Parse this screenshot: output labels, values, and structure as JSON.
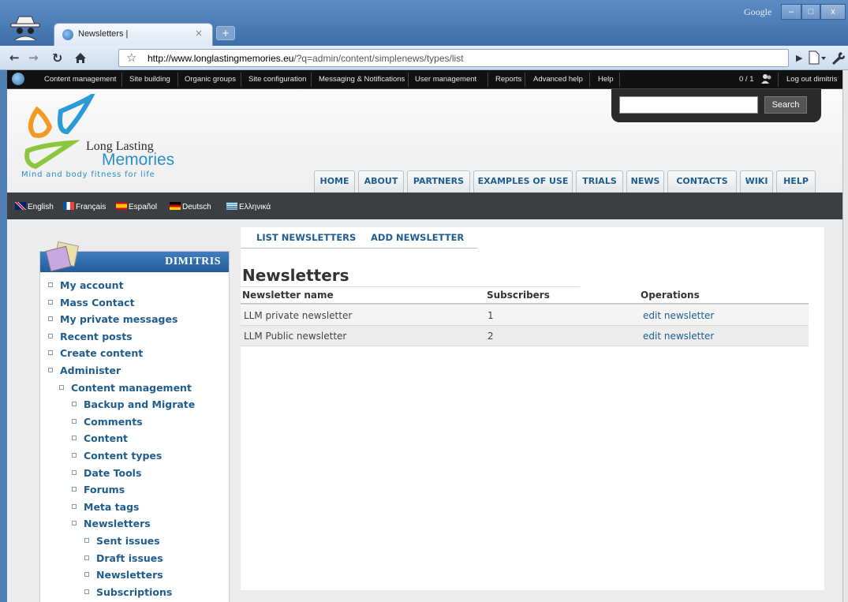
{
  "browser": {
    "tab_title": "Newsletters |",
    "tab_close": "×",
    "new_tab": "+",
    "google_label": "Google",
    "url_host": "http://www.longlastingmemories.eu",
    "url_path": "/?q=admin/content/simplenews/types/list",
    "window_min": "–",
    "window_max": "□",
    "window_close": "x"
  },
  "admin_bar": {
    "items": [
      "Content management",
      "Site building",
      "Organic groups",
      "Site configuration",
      "Messaging & Notifications",
      "User management",
      "Reports",
      "Advanced help",
      "Help"
    ],
    "user_count": "0 / 1",
    "logout": "Log out dimitris"
  },
  "header": {
    "logo_line1": "Long Lasting",
    "logo_line2": "Memories",
    "tagline": "Mind and body fitness for life",
    "search_button": "Search",
    "nav": [
      "HOME",
      "ABOUT",
      "PARTNERS",
      "EXAMPLES OF USE",
      "TRIALS",
      "NEWS",
      "CONTACTS",
      "WIKI",
      "HELP"
    ]
  },
  "languages": [
    "English",
    "Français",
    "Español",
    "Deutsch",
    "Ελληνικά"
  ],
  "sidebar": {
    "title": "DIMITRIS",
    "items": [
      {
        "label": "My account",
        "level": 0
      },
      {
        "label": "Mass Contact",
        "level": 0
      },
      {
        "label": "My private messages",
        "level": 0
      },
      {
        "label": "Recent posts",
        "level": 0
      },
      {
        "label": "Create content",
        "level": 0
      },
      {
        "label": "Administer",
        "level": 0
      },
      {
        "label": "Content management",
        "level": 1
      },
      {
        "label": "Backup and Migrate",
        "level": 2
      },
      {
        "label": "Comments",
        "level": 2
      },
      {
        "label": "Content",
        "level": 2
      },
      {
        "label": "Content types",
        "level": 2
      },
      {
        "label": "Date Tools",
        "level": 2
      },
      {
        "label": "Forums",
        "level": 2
      },
      {
        "label": "Meta tags",
        "level": 2
      },
      {
        "label": "Newsletters",
        "level": 2
      },
      {
        "label": "Sent issues",
        "level": 3
      },
      {
        "label": "Draft issues",
        "level": 3
      },
      {
        "label": "Newsletters",
        "level": 3
      },
      {
        "label": "Subscriptions",
        "level": 3
      }
    ]
  },
  "main": {
    "tabs": [
      "LIST NEWSLETTERS",
      "ADD NEWSLETTER"
    ],
    "title": "Newsletters",
    "columns": [
      "Newsletter name",
      "Subscribers",
      "Operations"
    ],
    "rows": [
      {
        "name": "LLM private newsletter",
        "subscribers": "1",
        "operation": "edit newsletter"
      },
      {
        "name": "LLM Public newsletter",
        "subscribers": "2",
        "operation": "edit newsletter"
      }
    ]
  }
}
